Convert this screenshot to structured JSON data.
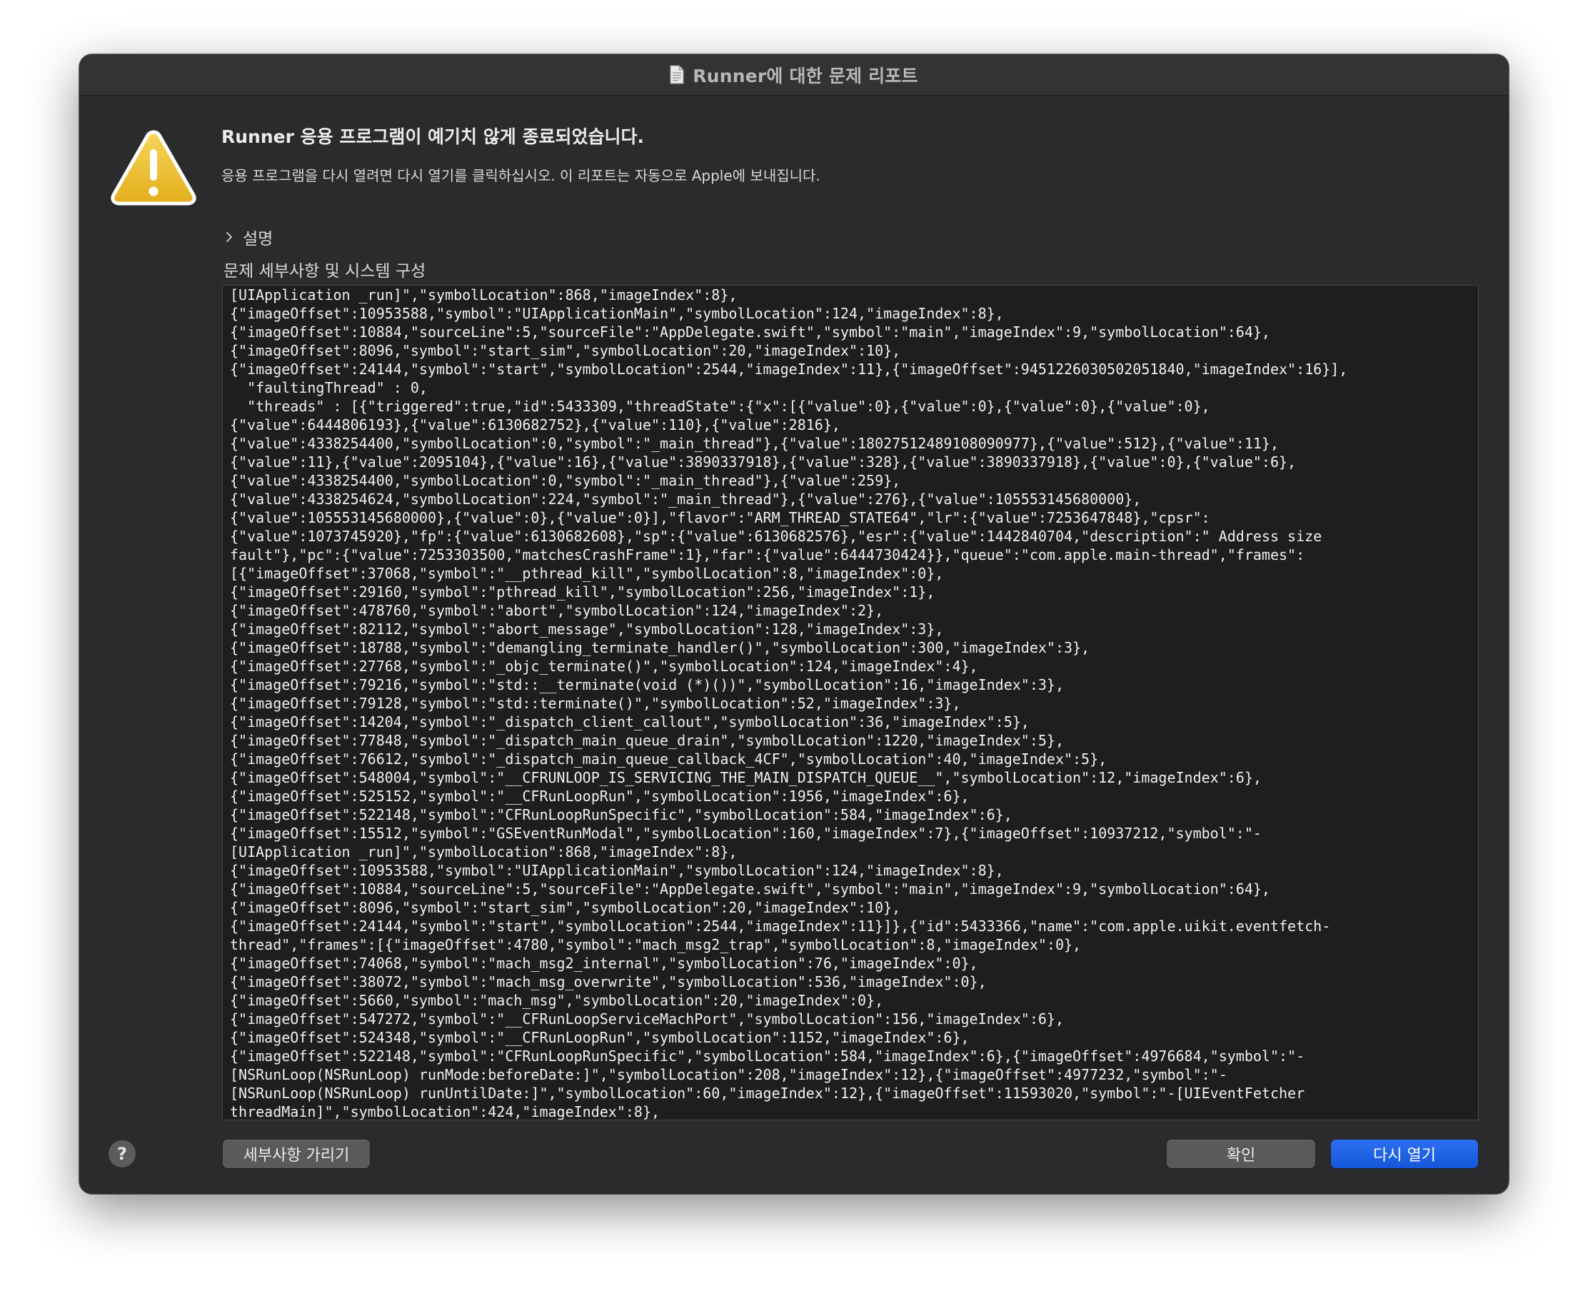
{
  "window": {
    "title": "Runner에 대한 문제 리포트"
  },
  "alert": {
    "headline": "Runner 응용 프로그램이 예기치 않게 종료되었습니다.",
    "message": "응용 프로그램을 다시 열려면 다시 열기를 클릭하십시오. 이 리포트는 자동으로 Apple에 보내집니다."
  },
  "description": {
    "label": "설명"
  },
  "details": {
    "label": "문제 세부사항 및 시스템 구성",
    "lines": [
      "[UIApplication _run]\",\"symbolLocation\":868,\"imageIndex\":8},",
      "{\"imageOffset\":10953588,\"symbol\":\"UIApplicationMain\",\"symbolLocation\":124,\"imageIndex\":8},",
      "{\"imageOffset\":10884,\"sourceLine\":5,\"sourceFile\":\"AppDelegate.swift\",\"symbol\":\"main\",\"imageIndex\":9,\"symbolLocation\":64},",
      "{\"imageOffset\":8096,\"symbol\":\"start_sim\",\"symbolLocation\":20,\"imageIndex\":10},",
      "{\"imageOffset\":24144,\"symbol\":\"start\",\"symbolLocation\":2544,\"imageIndex\":11},{\"imageOffset\":9451226030502051840,\"imageIndex\":16}],",
      "  \"faultingThread\" : 0,",
      "  \"threads\" : [{\"triggered\":true,\"id\":5433309,\"threadState\":{\"x\":[{\"value\":0},{\"value\":0},{\"value\":0},{\"value\":0},",
      "{\"value\":6444806193},{\"value\":6130682752},{\"value\":110},{\"value\":2816},",
      "{\"value\":4338254400,\"symbolLocation\":0,\"symbol\":\"_main_thread\"},{\"value\":18027512489108090977},{\"value\":512},{\"value\":11},",
      "{\"value\":11},{\"value\":2095104},{\"value\":16},{\"value\":3890337918},{\"value\":328},{\"value\":3890337918},{\"value\":0},{\"value\":6},",
      "{\"value\":4338254400,\"symbolLocation\":0,\"symbol\":\"_main_thread\"},{\"value\":259},",
      "{\"value\":4338254624,\"symbolLocation\":224,\"symbol\":\"_main_thread\"},{\"value\":276},{\"value\":105553145680000},",
      "{\"value\":105553145680000},{\"value\":0},{\"value\":0}],\"flavor\":\"ARM_THREAD_STATE64\",\"lr\":{\"value\":7253647848},\"cpsr\":",
      "{\"value\":1073745920},\"fp\":{\"value\":6130682608},\"sp\":{\"value\":6130682576},\"esr\":{\"value\":1442840704,\"description\":\" Address size",
      "fault\"},\"pc\":{\"value\":7253303500,\"matchesCrashFrame\":1},\"far\":{\"value\":6444730424}},\"queue\":\"com.apple.main-thread\",\"frames\":",
      "[{\"imageOffset\":37068,\"symbol\":\"__pthread_kill\",\"symbolLocation\":8,\"imageIndex\":0},",
      "{\"imageOffset\":29160,\"symbol\":\"pthread_kill\",\"symbolLocation\":256,\"imageIndex\":1},",
      "{\"imageOffset\":478760,\"symbol\":\"abort\",\"symbolLocation\":124,\"imageIndex\":2},",
      "{\"imageOffset\":82112,\"symbol\":\"abort_message\",\"symbolLocation\":128,\"imageIndex\":3},",
      "{\"imageOffset\":18788,\"symbol\":\"demangling_terminate_handler()\",\"symbolLocation\":300,\"imageIndex\":3},",
      "{\"imageOffset\":27768,\"symbol\":\"_objc_terminate()\",\"symbolLocation\":124,\"imageIndex\":4},",
      "{\"imageOffset\":79216,\"symbol\":\"std::__terminate(void (*)())\",\"symbolLocation\":16,\"imageIndex\":3},",
      "{\"imageOffset\":79128,\"symbol\":\"std::terminate()\",\"symbolLocation\":52,\"imageIndex\":3},",
      "{\"imageOffset\":14204,\"symbol\":\"_dispatch_client_callout\",\"symbolLocation\":36,\"imageIndex\":5},",
      "{\"imageOffset\":77848,\"symbol\":\"_dispatch_main_queue_drain\",\"symbolLocation\":1220,\"imageIndex\":5},",
      "{\"imageOffset\":76612,\"symbol\":\"_dispatch_main_queue_callback_4CF\",\"symbolLocation\":40,\"imageIndex\":5},",
      "{\"imageOffset\":548004,\"symbol\":\"__CFRUNLOOP_IS_SERVICING_THE_MAIN_DISPATCH_QUEUE__\",\"symbolLocation\":12,\"imageIndex\":6},",
      "{\"imageOffset\":525152,\"symbol\":\"__CFRunLoopRun\",\"symbolLocation\":1956,\"imageIndex\":6},",
      "{\"imageOffset\":522148,\"symbol\":\"CFRunLoopRunSpecific\",\"symbolLocation\":584,\"imageIndex\":6},",
      "{\"imageOffset\":15512,\"symbol\":\"GSEventRunModal\",\"symbolLocation\":160,\"imageIndex\":7},{\"imageOffset\":10937212,\"symbol\":\"-",
      "[UIApplication _run]\",\"symbolLocation\":868,\"imageIndex\":8},",
      "{\"imageOffset\":10953588,\"symbol\":\"UIApplicationMain\",\"symbolLocation\":124,\"imageIndex\":8},",
      "{\"imageOffset\":10884,\"sourceLine\":5,\"sourceFile\":\"AppDelegate.swift\",\"symbol\":\"main\",\"imageIndex\":9,\"symbolLocation\":64},",
      "{\"imageOffset\":8096,\"symbol\":\"start_sim\",\"symbolLocation\":20,\"imageIndex\":10},",
      "{\"imageOffset\":24144,\"symbol\":\"start\",\"symbolLocation\":2544,\"imageIndex\":11}]},{\"id\":5433366,\"name\":\"com.apple.uikit.eventfetch-",
      "thread\",\"frames\":[{\"imageOffset\":4780,\"symbol\":\"mach_msg2_trap\",\"symbolLocation\":8,\"imageIndex\":0},",
      "{\"imageOffset\":74068,\"symbol\":\"mach_msg2_internal\",\"symbolLocation\":76,\"imageIndex\":0},",
      "{\"imageOffset\":38072,\"symbol\":\"mach_msg_overwrite\",\"symbolLocation\":536,\"imageIndex\":0},",
      "{\"imageOffset\":5660,\"symbol\":\"mach_msg\",\"symbolLocation\":20,\"imageIndex\":0},",
      "{\"imageOffset\":547272,\"symbol\":\"__CFRunLoopServiceMachPort\",\"symbolLocation\":156,\"imageIndex\":6},",
      "{\"imageOffset\":524348,\"symbol\":\"__CFRunLoopRun\",\"symbolLocation\":1152,\"imageIndex\":6},",
      "{\"imageOffset\":522148,\"symbol\":\"CFRunLoopRunSpecific\",\"symbolLocation\":584,\"imageIndex\":6},{\"imageOffset\":4976684,\"symbol\":\"-",
      "[NSRunLoop(NSRunLoop) runMode:beforeDate:]\",\"symbolLocation\":208,\"imageIndex\":12},{\"imageOffset\":4977232,\"symbol\":\"-",
      "[NSRunLoop(NSRunLoop) runUntilDate:]\",\"symbolLocation\":60,\"imageIndex\":12},{\"imageOffset\":11593020,\"symbol\":\"-[UIEventFetcher",
      "threadMain]\",\"symbolLocation\":424,\"imageIndex\":8},"
    ]
  },
  "buttons": {
    "help": "?",
    "hide_details": "세부사항 가리기",
    "ok": "확인",
    "reopen": "다시 열기"
  },
  "icons": {
    "document": "document-icon",
    "warning": "warning-icon",
    "disclosure": "chevron-right-icon"
  },
  "colors": {
    "window_bg": "#2b2b2d",
    "details_bg": "#1e1e1e",
    "primary_button": "#1661e6",
    "secondary_button": "#5a5a5c",
    "warning_yellow": "#f2c230"
  }
}
